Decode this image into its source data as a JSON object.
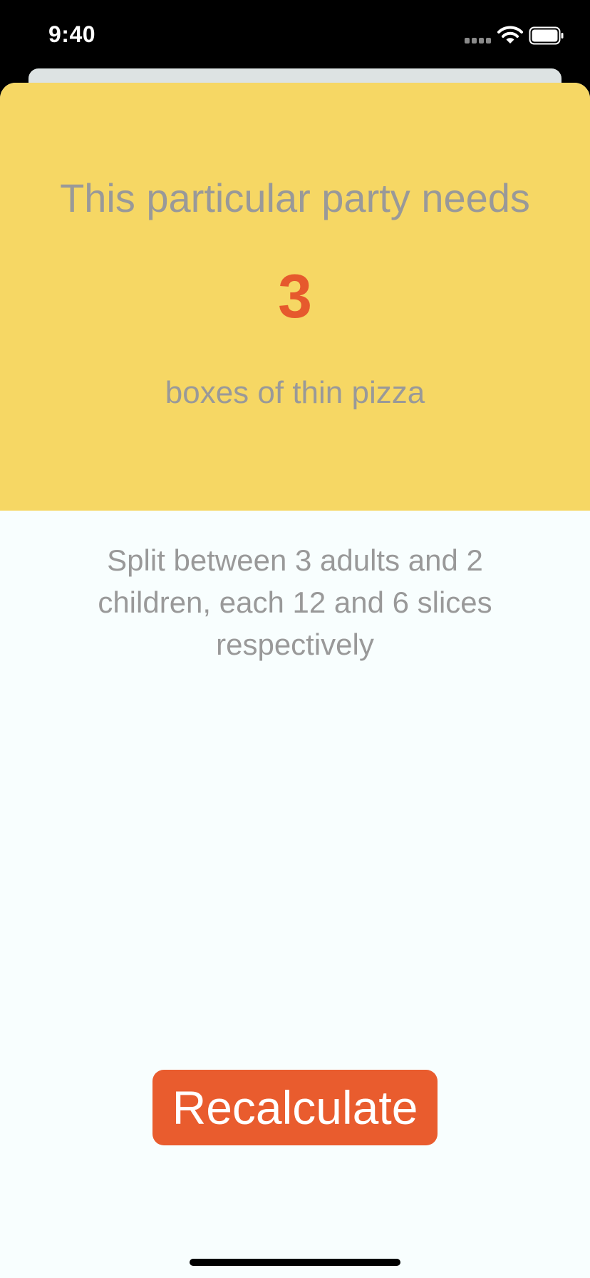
{
  "status_bar": {
    "time": "9:40",
    "icons": [
      "cellular-signal-icon",
      "wifi-icon",
      "battery-icon"
    ]
  },
  "result": {
    "headline": "This particular party needs",
    "box_count": "3",
    "unit_label": "boxes of thin pizza"
  },
  "split_description": "Split between 3 adults and 2 children, each 12 and 6 slices respectively",
  "actions": {
    "recalculate_label": "Recalculate"
  },
  "colors": {
    "result_background": "#f6d764",
    "accent": "#e95c2e",
    "count_text": "#e6592d",
    "secondary_text": "#999999",
    "sheet_background": "#f8fefe"
  }
}
